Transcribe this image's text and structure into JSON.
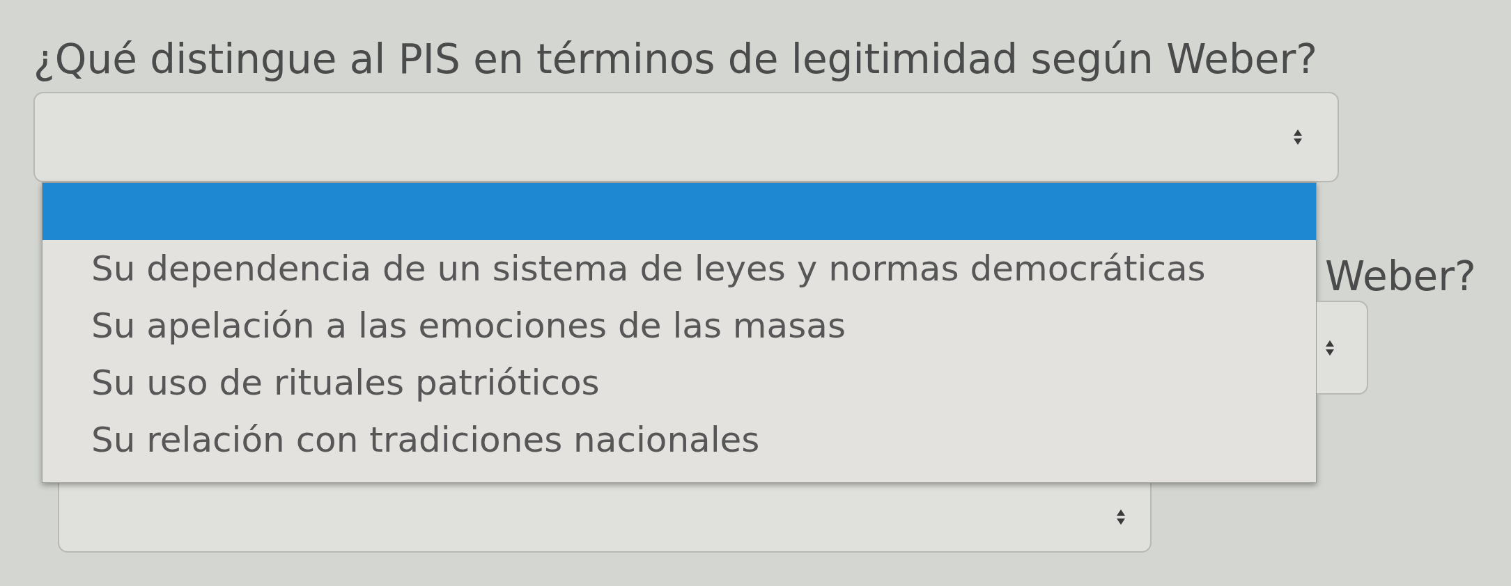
{
  "questions": [
    {
      "text": "¿Qué distingue al PIS en términos de legitimidad según Weber?",
      "select": {
        "expanded": true,
        "options": [
          {
            "selected": true
          },
          {
            "label": "Su dependencia de un sistema de leyes y normas democráticas",
            "selected": false
          },
          {
            "label": "Su apelación a las emociones de las masas",
            "selected": false
          },
          {
            "label": "Su uso de rituales patrióticos",
            "selected": false
          },
          {
            "label": "Su relación con tradiciones nacionales",
            "selected": false
          }
        ]
      }
    },
    {
      "text": "Weber?",
      "select": {
        "expanded": false
      }
    },
    {
      "select": {
        "expanded": false
      }
    }
  ]
}
